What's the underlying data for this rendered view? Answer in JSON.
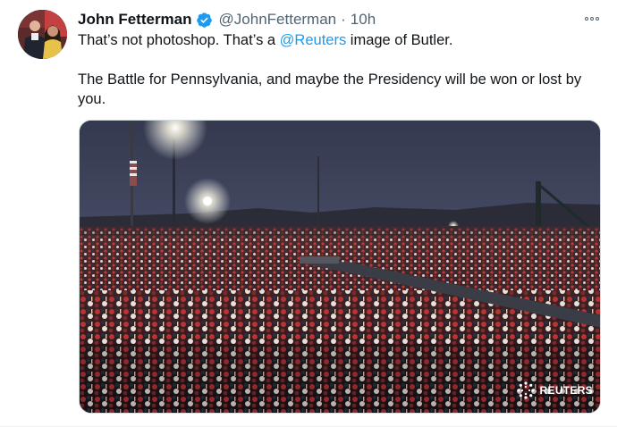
{
  "tweet": {
    "author": {
      "display_name": "John Fetterman",
      "handle": "@JohnFetterman",
      "verified": true
    },
    "separator": "·",
    "time": "10h",
    "more_icon": "more-horizontal-icon",
    "text": {
      "line1_a": "That’s not photoshop.  That’s a ",
      "line1_mention": "@Reuters",
      "line1_b": " image of Butler.",
      "line2": "The Battle for Pennsylvania, and maybe the Presidency will be won or lost by you."
    },
    "media": {
      "watermark": "REUTERS"
    }
  },
  "colors": {
    "link": "#1d9bf0",
    "secondary_text": "#536471",
    "primary_text": "#0f1419",
    "verified_badge": "#1d9bf0"
  }
}
